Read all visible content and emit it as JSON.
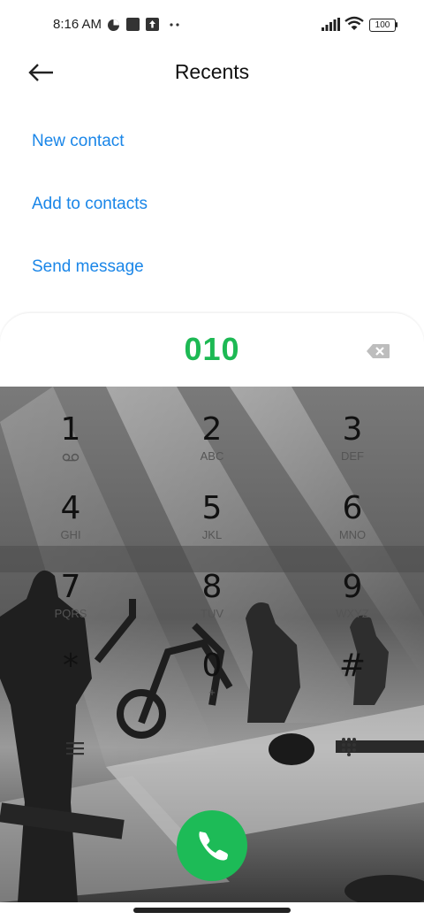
{
  "status_bar": {
    "time": "8:16 AM",
    "battery": "100"
  },
  "header": {
    "title": "Recents"
  },
  "actions": [
    {
      "label": "New contact"
    },
    {
      "label": "Add to contacts"
    },
    {
      "label": "Send message"
    }
  ],
  "dialer": {
    "number": "010",
    "keys": [
      {
        "digit": "1",
        "letters": ""
      },
      {
        "digit": "2",
        "letters": "ABC"
      },
      {
        "digit": "3",
        "letters": "DEF"
      },
      {
        "digit": "4",
        "letters": "GHI"
      },
      {
        "digit": "5",
        "letters": "JKL"
      },
      {
        "digit": "6",
        "letters": "MNO"
      },
      {
        "digit": "7",
        "letters": "PQRS"
      },
      {
        "digit": "8",
        "letters": "TUV"
      },
      {
        "digit": "9",
        "letters": "WXYZ"
      },
      {
        "digit": "*",
        "letters": ""
      },
      {
        "digit": "0",
        "letters": "+"
      },
      {
        "digit": "#",
        "letters": ""
      }
    ]
  },
  "colors": {
    "accent_blue": "#1a86e8",
    "number_green": "#1db954",
    "call_green": "#1dbb57"
  },
  "icons": [
    "back-arrow-icon",
    "backspace-icon",
    "voicemail-icon",
    "menu-icon",
    "dialpad-icon",
    "phone-icon",
    "signal-icon",
    "wifi-icon",
    "battery-icon"
  ]
}
